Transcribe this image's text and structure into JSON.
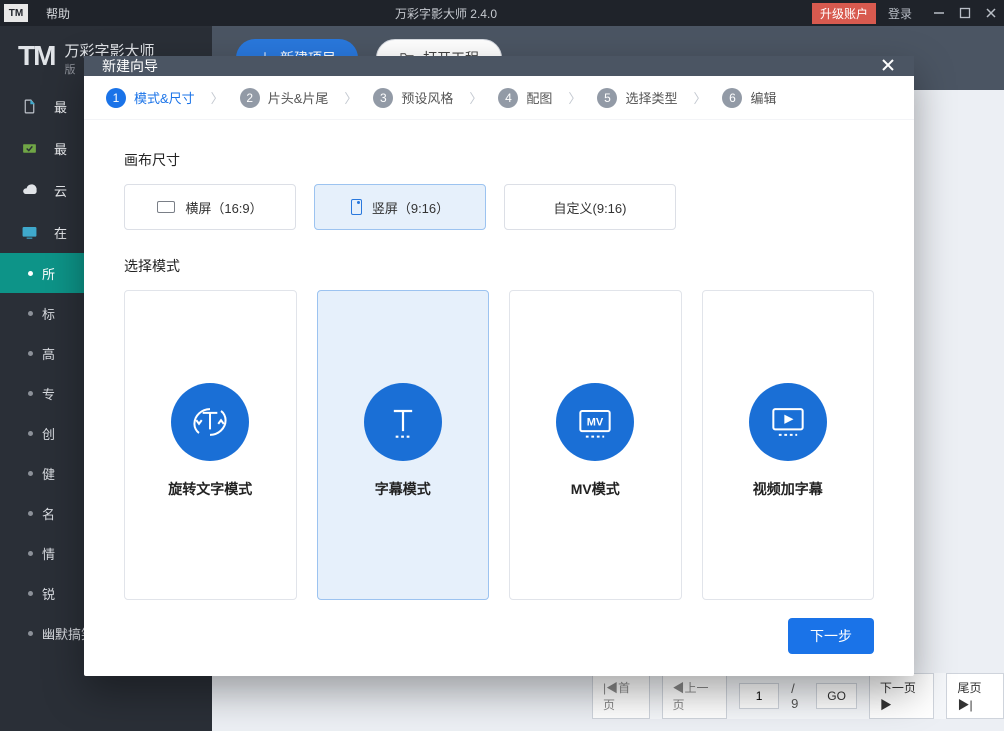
{
  "titlebar": {
    "help": "帮助",
    "app_title": "万彩字影大师 2.4.0",
    "upgrade": "升级账户",
    "login": "登录"
  },
  "branding": {
    "logo": "TM",
    "name": "万彩字影大师",
    "version_prefix": "版"
  },
  "sidebar_top": [
    {
      "icon": "file",
      "label": "最"
    },
    {
      "icon": "check",
      "label": "最"
    },
    {
      "icon": "cloud",
      "label": "云"
    },
    {
      "icon": "screen",
      "label": "在"
    }
  ],
  "sidebar_cats": [
    {
      "label": "所",
      "active": true
    },
    {
      "label": "标"
    },
    {
      "label": "高"
    },
    {
      "label": "专"
    },
    {
      "label": "创"
    },
    {
      "label": "健"
    },
    {
      "label": "名"
    },
    {
      "label": "情"
    },
    {
      "label": "锐"
    },
    {
      "label": "幽默搞笑"
    }
  ],
  "toolbar": {
    "new_project": "新建项目",
    "open_project": "打开工程"
  },
  "pager": {
    "first": "|◀首页",
    "prev": "◀上一页",
    "page": "1",
    "total": "/ 9",
    "go": "GO",
    "next": "下一页▶",
    "last": "尾页▶|"
  },
  "wizard": {
    "title": "新建向导",
    "steps": [
      {
        "n": "1",
        "label": "模式&尺寸",
        "active": true
      },
      {
        "n": "2",
        "label": "片头&片尾"
      },
      {
        "n": "3",
        "label": "预设风格"
      },
      {
        "n": "4",
        "label": "配图"
      },
      {
        "n": "5",
        "label": "选择类型"
      },
      {
        "n": "6",
        "label": "编辑"
      }
    ],
    "sect_size": "画布尺寸",
    "sizes": [
      {
        "label": "横屏（16:9）"
      },
      {
        "label": "竖屏（9:16）",
        "selected": true
      },
      {
        "label": "自定义(9:16)"
      }
    ],
    "sect_mode": "选择模式",
    "modes": [
      {
        "label": "旋转文字模式",
        "icon": "rotate-text"
      },
      {
        "label": "字幕模式",
        "icon": "text",
        "selected": true
      },
      {
        "label": "MV模式",
        "icon": "mv"
      },
      {
        "label": "视频加字幕",
        "icon": "video-sub"
      }
    ],
    "next": "下一步"
  }
}
